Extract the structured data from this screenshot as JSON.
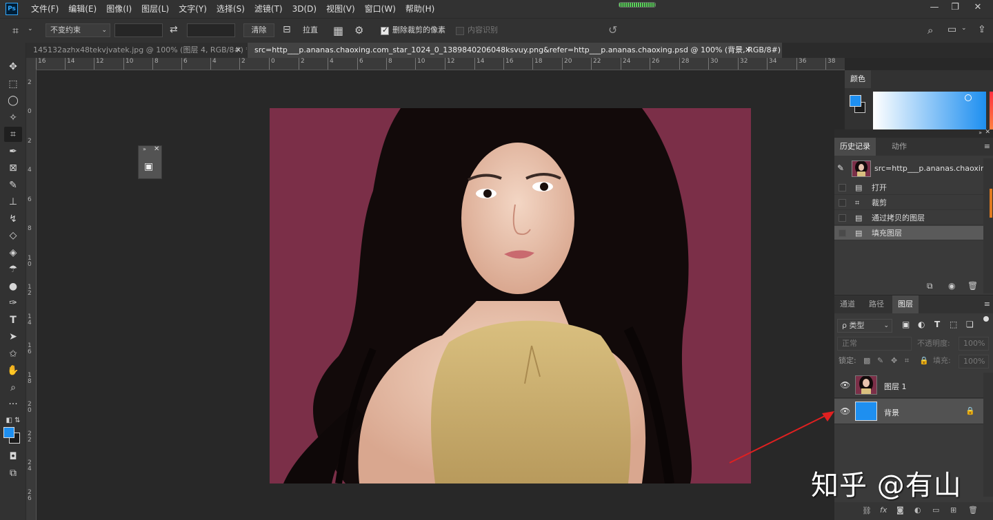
{
  "app": {
    "logo": "Ps",
    "progress_fraction": 0.6
  },
  "menu": [
    "文件(F)",
    "编辑(E)",
    "图像(I)",
    "图层(L)",
    "文字(Y)",
    "选择(S)",
    "滤镜(T)",
    "3D(D)",
    "视图(V)",
    "窗口(W)",
    "帮助(H)"
  ],
  "window_controls": {
    "minimize": "—",
    "restore": "❐",
    "close": "✕"
  },
  "options": {
    "ratio_value": "不变约束",
    "swap_icon": "⇄",
    "clear_label": "清除",
    "straighten_label": "拉直",
    "delete_cropped_label": "删除裁剪的像素",
    "delete_cropped_checked": true,
    "content_aware_label": "内容识别",
    "content_aware_checked": false
  },
  "tabs": [
    {
      "title": "145132azhx48tekvjvatek.jpg @ 100% (图层 4, RGB/8#) *",
      "active": false
    },
    {
      "title": "src=http___p.ananas.chaoxing.com_star_1024_0_1389840206048ksvuy.png&refer=http___p.ananas.chaoxing.psd @ 100% (背景, RGB/8#) *",
      "active": true
    }
  ],
  "ruler_top": [
    "16",
    "14",
    "12",
    "10",
    "8",
    "6",
    "4",
    "2",
    "0",
    "2",
    "4",
    "6",
    "8",
    "10",
    "12",
    "14",
    "16",
    "18",
    "20",
    "22",
    "24",
    "26",
    "28",
    "30",
    "32",
    "34",
    "36",
    "38"
  ],
  "ruler_left": [
    "2",
    "0",
    "2",
    "4",
    "6",
    "8",
    "1\n0",
    "1\n2",
    "1\n4",
    "1\n6",
    "1\n8",
    "2\n0",
    "2\n2",
    "2\n4",
    "2\n6"
  ],
  "color_panel": {
    "title": "颜色",
    "fg_color": "#1e8ff0",
    "bg_color": "#1a1a1a"
  },
  "history": {
    "tabs": [
      "历史记录",
      "动作"
    ],
    "snapshot_label": "src=http___p.ananas.chaoxin...",
    "items": [
      "打开",
      "裁剪",
      "通过拷贝的图层",
      "填充图层"
    ]
  },
  "layers": {
    "tabs": [
      "通道",
      "路径",
      "图层"
    ],
    "filter_label": "ρ 类型",
    "blend_mode": "正常",
    "opacity_label": "不透明度:",
    "opacity_value": "100%",
    "lock_label": "锁定:",
    "fill_label": "填充:",
    "fill_value": "100%",
    "items": [
      {
        "name": "图层 1",
        "thumb": "photo",
        "visible": true,
        "locked": false
      },
      {
        "name": "背景",
        "thumb": "#1e8ff0",
        "visible": true,
        "locked": true
      }
    ]
  },
  "watermark": "知乎 @有山"
}
